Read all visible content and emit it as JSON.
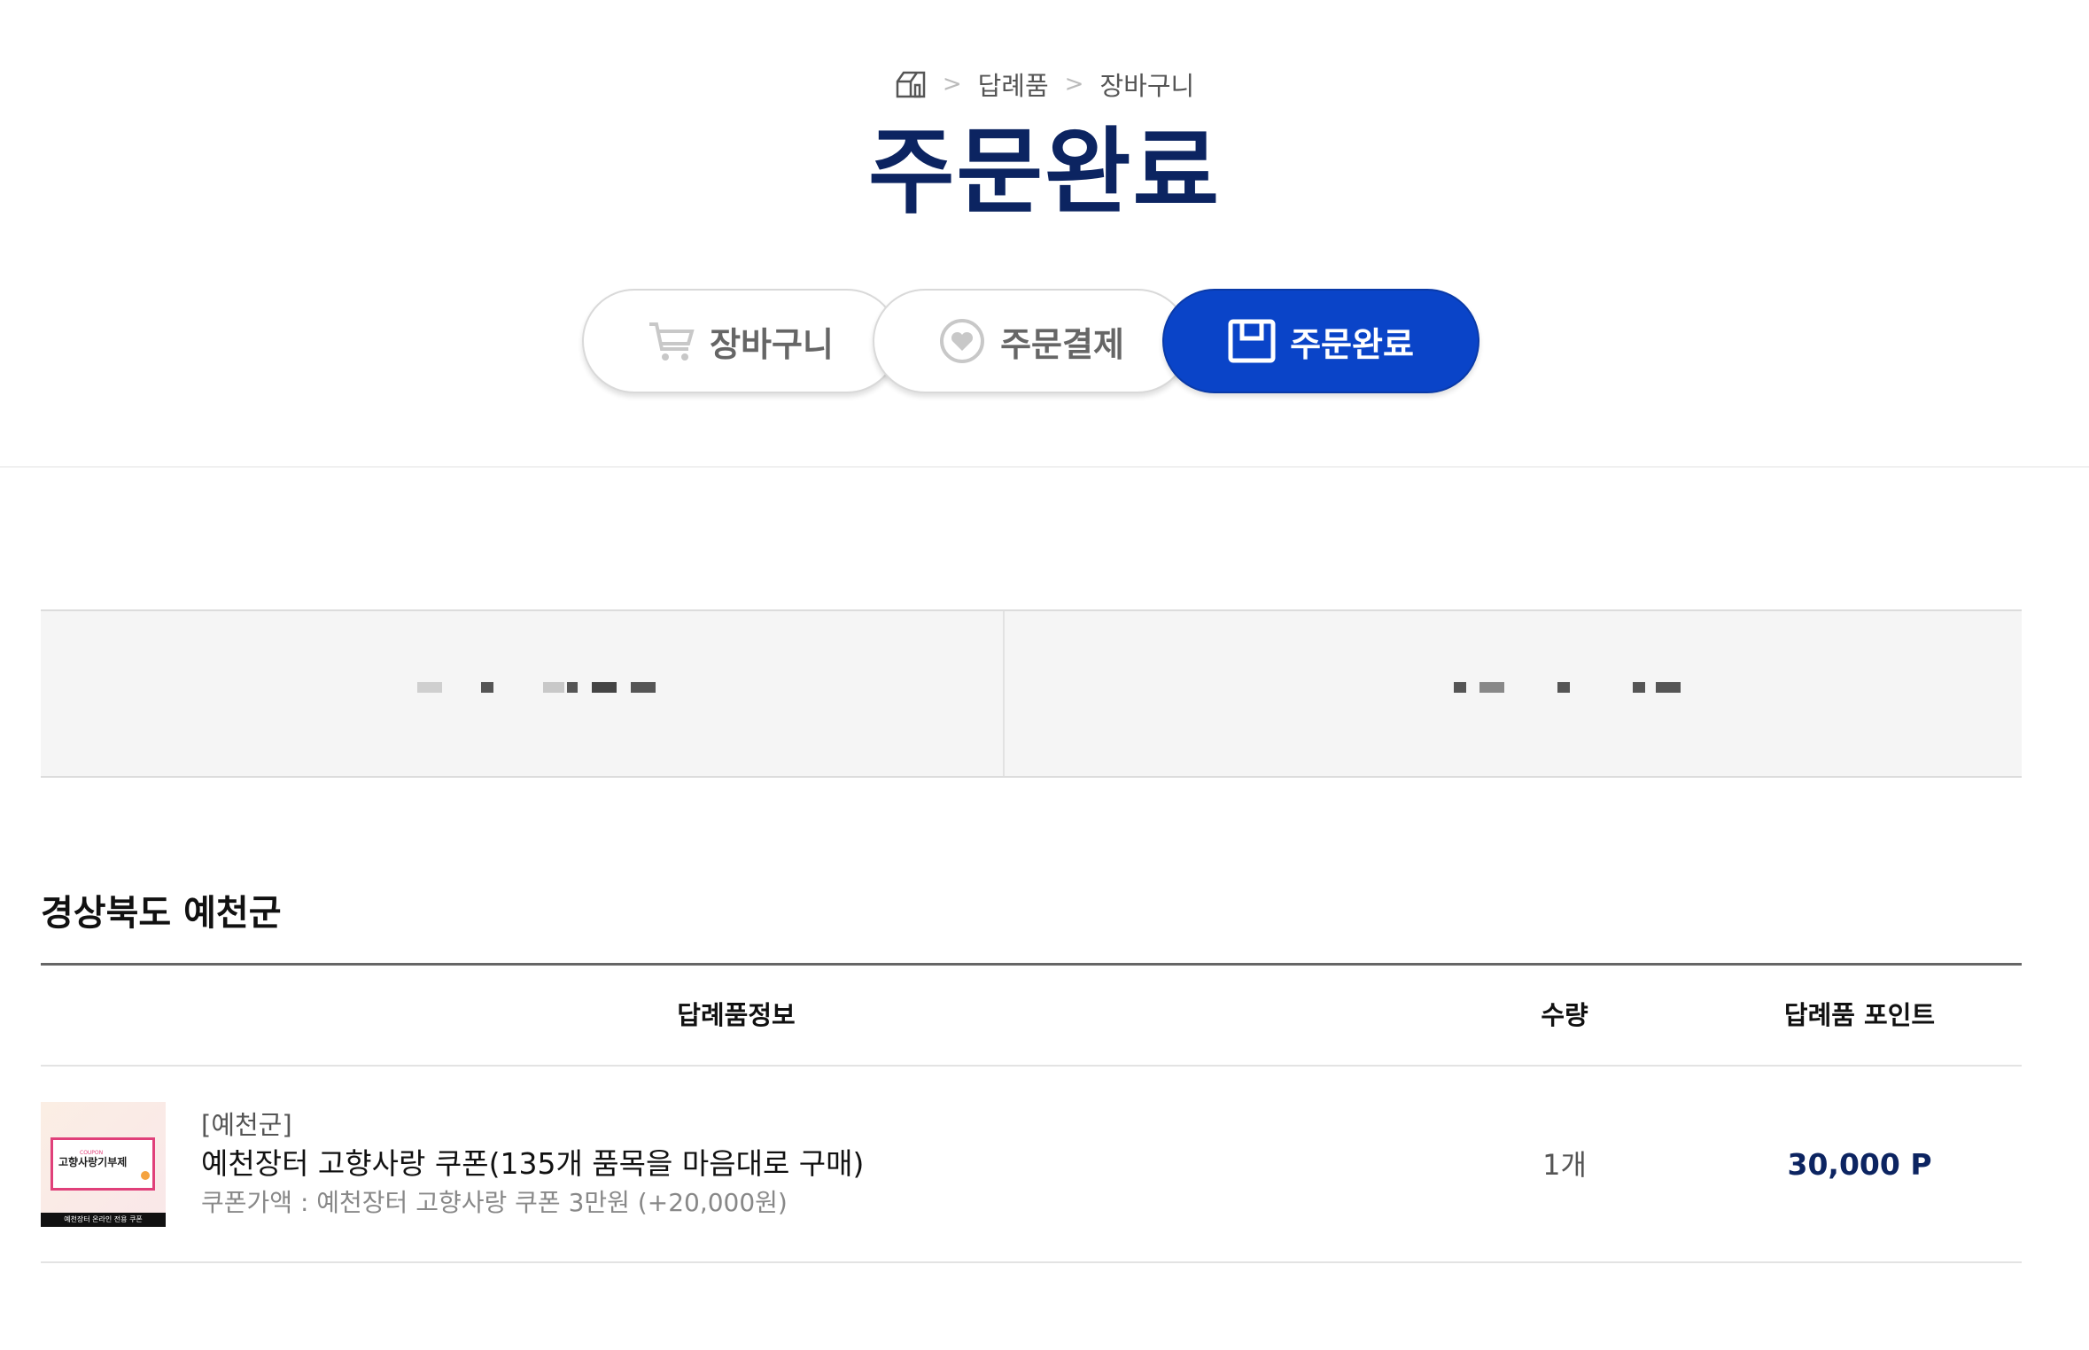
{
  "breadcrumb": {
    "items": [
      "답례품",
      "장바구니"
    ]
  },
  "page_title": "주문완료",
  "steps": [
    {
      "label": "장바구니",
      "icon": "cart-icon",
      "active": false
    },
    {
      "label": "주문결제",
      "icon": "heart-circle-icon",
      "active": false
    },
    {
      "label": "주문완료",
      "icon": "box-icon",
      "active": true
    }
  ],
  "region_title": "경상북도 예천군",
  "table": {
    "headers": {
      "info": "답례품정보",
      "qty": "수량",
      "points": "답례품 포인트"
    },
    "rows": [
      {
        "region": "[예천군]",
        "name": "예천장터 고향사랑 쿠폰(135개 품목을 마음대로 구매)",
        "option": "쿠폰가액 : 예천장터 고향사랑 쿠폰 3만원 (+20,000원)",
        "qty": "1개",
        "points": "30,000 P",
        "thumb": {
          "title": "고향사랑기부제",
          "tag": "COUPON",
          "footer": "예천장터 온라인 전용 쿠폰"
        }
      }
    ]
  },
  "colors": {
    "primary": "#0a44c8",
    "title": "#0c2461"
  }
}
